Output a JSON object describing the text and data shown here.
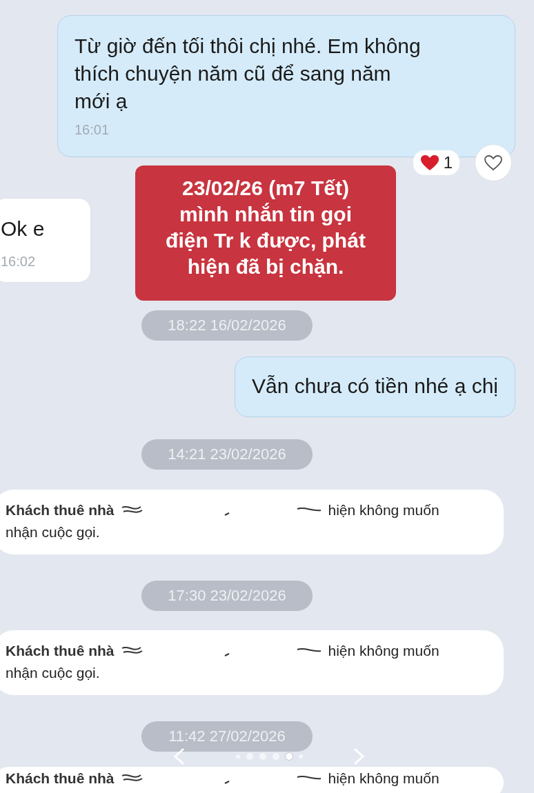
{
  "messages": [
    {
      "kind": "outgoing",
      "text": "Từ giờ đến tối thôi chị nhé. Em không thích chuyện năm cũ để sang năm mới ạ",
      "time": "16:01",
      "reaction_count": "1"
    },
    {
      "kind": "incoming",
      "text": "Ok e",
      "time": "16:02"
    },
    {
      "kind": "timestamp",
      "text": "18:22 16/02/2026"
    },
    {
      "kind": "outgoing",
      "text": "Vẫn chưa có tiền nhé ạ chị"
    },
    {
      "kind": "timestamp",
      "text": "14:21 23/02/2026"
    },
    {
      "kind": "notice",
      "name": "Khách thuê nhà",
      "text": "hiện không muốn",
      "text_2": "nhận cuộc gọi."
    },
    {
      "kind": "timestamp",
      "text": "17:30 23/02/2026"
    },
    {
      "kind": "notice",
      "name": "Khách thuê nhà",
      "text": "hiện không muốn",
      "text_2": "nhận cuộc gọi."
    },
    {
      "kind": "timestamp",
      "text": "11:42 27/02/2026"
    },
    {
      "kind": "notice",
      "name": "Khách thuê nhà",
      "text": "hiện không muốn"
    }
  ],
  "annotation": {
    "text": "23/02/26 (m7 Tết)\nmình nhắn tin gọi\nđiện Tr k được, phát\nhiện đã bị chặn."
  },
  "carousel": {
    "pages": [
      {
        "selected": false
      },
      {
        "selected": false
      },
      {
        "selected": false
      },
      {
        "selected": false
      },
      {
        "selected": true
      },
      {
        "selected": false
      }
    ]
  }
}
